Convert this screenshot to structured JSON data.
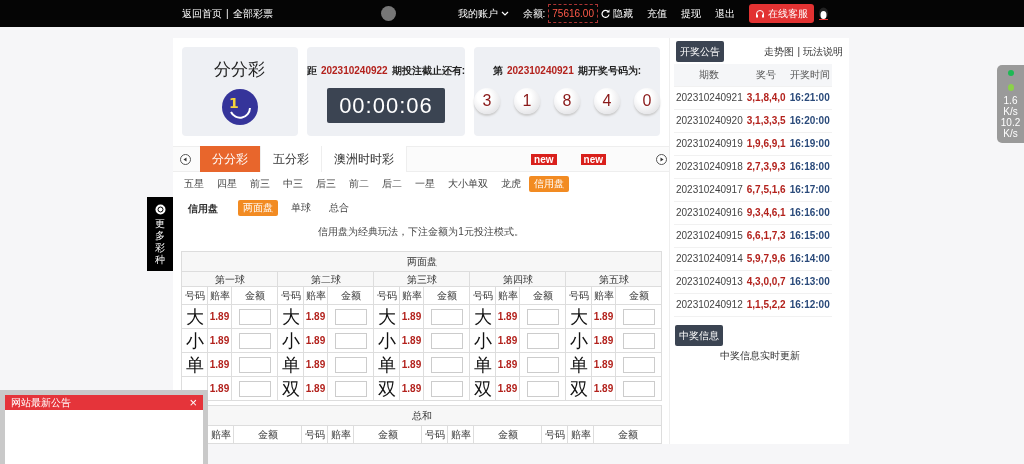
{
  "top_bar": {
    "left_links": [
      "返回首页",
      "全部彩票"
    ],
    "separator": "|",
    "account": "我的账户",
    "balance_label": "余额:",
    "balance": "75616.00",
    "hide": "隐藏",
    "actions": [
      "充值",
      "提现",
      "退出"
    ],
    "service": "在线客服"
  },
  "side_tab": {
    "label": "更多彩种"
  },
  "header": {
    "game": "分分彩",
    "logo": {
      "digit": "1"
    },
    "countdown": {
      "prefix": "距",
      "issue": "202310240922",
      "suffix": "期投注截止还有:",
      "time": "00:00:06"
    },
    "result": {
      "prefix": "第",
      "issue": "202310240921",
      "suffix": "期开奖号码为:",
      "balls": [
        "3",
        "1",
        "8",
        "4",
        "0"
      ]
    }
  },
  "game_tabs": [
    {
      "label": "分分彩",
      "selected": true
    },
    {
      "label": "五分彩",
      "selected": false
    },
    {
      "label": "澳洲时时彩",
      "selected": false
    }
  ],
  "new_tags": [
    "new",
    "new"
  ],
  "play_tabs": [
    {
      "label": "五星",
      "selected": false
    },
    {
      "label": "四星",
      "selected": false
    },
    {
      "label": "前三",
      "selected": false
    },
    {
      "label": "中三",
      "selected": false
    },
    {
      "label": "后三",
      "selected": false
    },
    {
      "label": "前二",
      "selected": false
    },
    {
      "label": "后二",
      "selected": false
    },
    {
      "label": "一星",
      "selected": false
    },
    {
      "label": "大小单双",
      "selected": false
    },
    {
      "label": "龙虎",
      "selected": false
    },
    {
      "label": "信用盘",
      "selected": true
    }
  ],
  "mode": {
    "label": "信用盘",
    "tabs": [
      {
        "label": "两面盘",
        "selected": true
      },
      {
        "label": "单球",
        "selected": false
      },
      {
        "label": "总合",
        "selected": false
      }
    ]
  },
  "notice": "信用盘为经典玩法，下注金额为1元投注模式。",
  "two_sides": {
    "title": "两面盘",
    "balls": [
      {
        "title": "第一球",
        "columns": [
          "号码",
          "赔率",
          "金额"
        ],
        "rows": [
          {
            "label": "大",
            "odds": "1.89"
          },
          {
            "label": "小",
            "odds": "1.89"
          },
          {
            "label": "单",
            "odds": "1.89"
          },
          {
            "odds": "1.89"
          }
        ]
      },
      {
        "title": "第二球",
        "columns": [
          "号码",
          "赔率",
          "金额"
        ],
        "rows": [
          {
            "label": "大",
            "odds": "1.89"
          },
          {
            "label": "小",
            "odds": "1.89"
          },
          {
            "label": "单",
            "odds": "1.89"
          },
          {
            "label": "双",
            "odds": "1.89"
          }
        ]
      },
      {
        "title": "第三球",
        "columns": [
          "号码",
          "赔率",
          "金额"
        ],
        "rows": [
          {
            "label": "大",
            "odds": "1.89"
          },
          {
            "label": "小",
            "odds": "1.89"
          },
          {
            "label": "单",
            "odds": "1.89"
          },
          {
            "label": "双",
            "odds": "1.89"
          }
        ]
      },
      {
        "title": "第四球",
        "columns": [
          "号码",
          "赔率",
          "金额"
        ],
        "rows": [
          {
            "label": "大",
            "odds": "1.89"
          },
          {
            "label": "小",
            "odds": "1.89"
          },
          {
            "label": "单",
            "odds": "1.89"
          },
          {
            "label": "双",
            "odds": "1.89"
          }
        ]
      },
      {
        "title": "第五球",
        "columns": [
          "号码",
          "赔率",
          "金额"
        ],
        "rows": [
          {
            "label": "大",
            "odds": "1.89"
          },
          {
            "label": "小",
            "odds": "1.89"
          },
          {
            "label": "单",
            "odds": "1.89"
          },
          {
            "label": "双",
            "odds": "1.89"
          }
        ]
      }
    ]
  },
  "sum_table": {
    "title": "总和",
    "groups": [
      {
        "odds": "赔率",
        "amount": "金额"
      },
      {
        "number": "号码",
        "odds": "赔率",
        "amount": "金额"
      },
      {
        "number": "号码",
        "odds": "赔率",
        "amount": "金额"
      },
      {
        "number": "号码",
        "odds": "赔率",
        "amount": "金额"
      }
    ]
  },
  "draws": {
    "button": "开奖公告",
    "links": [
      "走势图",
      "玩法说明"
    ],
    "separator": "|",
    "columns": [
      "期数",
      "奖号",
      "开奖时间"
    ],
    "rows": [
      {
        "issue": "202310240921",
        "numbers": "3,1,8,4,0",
        "time": "16:21:00"
      },
      {
        "issue": "202310240920",
        "numbers": "3,1,3,3,5",
        "time": "16:20:00"
      },
      {
        "issue": "202310240919",
        "numbers": "1,9,6,9,1",
        "time": "16:19:00"
      },
      {
        "issue": "202310240918",
        "numbers": "2,7,3,9,3",
        "time": "16:18:00"
      },
      {
        "issue": "202310240917",
        "numbers": "6,7,5,1,6",
        "time": "16:17:00"
      },
      {
        "issue": "202310240916",
        "numbers": "9,3,4,6,1",
        "time": "16:16:00"
      },
      {
        "issue": "202310240915",
        "numbers": "6,6,1,7,3",
        "time": "16:15:00"
      },
      {
        "issue": "202310240914",
        "numbers": "5,9,7,9,6",
        "time": "16:14:00"
      },
      {
        "issue": "202310240913",
        "numbers": "4,3,0,0,7",
        "time": "16:13:00"
      },
      {
        "issue": "202310240912",
        "numbers": "1,1,5,2,2",
        "time": "16:12:00"
      }
    ]
  },
  "winners": {
    "button": "中奖信息",
    "text": "中奖信息实时更新"
  },
  "popup": {
    "title": "网站最新公告",
    "close": "×"
  },
  "speed_widget": [
    {
      "value": "1.6",
      "unit": "K/s"
    },
    {
      "value": "10.2",
      "unit": "K/s"
    }
  ]
}
